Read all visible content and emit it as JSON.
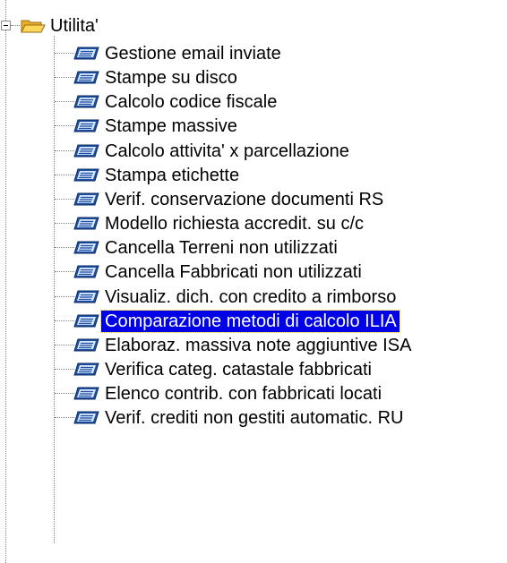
{
  "tree": {
    "root": {
      "label": "Utilita'",
      "icon": "folder-open-icon",
      "expanded": true
    },
    "items": [
      {
        "label": "Gestione email inviate",
        "icon": "form-icon"
      },
      {
        "label": "Stampe su disco",
        "icon": "form-icon"
      },
      {
        "label": "Calcolo codice fiscale",
        "icon": "form-icon"
      },
      {
        "label": "Stampe massive",
        "icon": "form-icon"
      },
      {
        "label": "Calcolo attivita' x parcellazione",
        "icon": "form-icon"
      },
      {
        "label": "Stampa etichette",
        "icon": "form-icon"
      },
      {
        "label": "Verif. conservazione documenti RS",
        "icon": "form-icon"
      },
      {
        "label": "Modello richiesta accredit. su c/c",
        "icon": "form-icon"
      },
      {
        "label": "Cancella Terreni non utilizzati",
        "icon": "form-icon"
      },
      {
        "label": "Cancella Fabbricati non utilizzati",
        "icon": "form-icon"
      },
      {
        "label": "Visualiz. dich. con credito a rimborso",
        "icon": "form-icon"
      },
      {
        "label": "Comparazione metodi di calcolo ILIA",
        "icon": "form-icon",
        "selected": true
      },
      {
        "label": "Elaboraz. massiva note aggiuntive ISA",
        "icon": "form-icon"
      },
      {
        "label": "Verifica categ. catastale fabbricati",
        "icon": "form-icon"
      },
      {
        "label": "Elenco contrib. con fabbricati locati",
        "icon": "form-icon"
      },
      {
        "label": "Verif. crediti non gestiti automatic. RU",
        "icon": "form-icon"
      }
    ]
  },
  "colors": {
    "selection_bg": "#0000e8",
    "selection_text": "#ffffff",
    "folder": "#f2c04a",
    "form_icon": "#1e50a0"
  }
}
